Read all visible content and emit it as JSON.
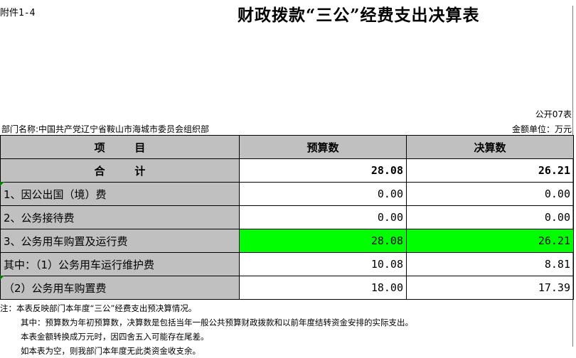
{
  "attachment": "附件1-4",
  "title": "财政拨款“三公”经费支出决算表",
  "form_number": "公开07表",
  "department": "部门名称:中国共产党辽宁省鞍山市海城市委员会组织部",
  "unit": "金额单位：万元",
  "headers": [
    "项        目",
    "预算数",
    "决算数"
  ],
  "rows": [
    {
      "label": "合        计",
      "budget": "28.08",
      "final": "26.21"
    },
    {
      "label": "1、因公出国（境）费",
      "budget": "0.00",
      "final": "0.00"
    },
    {
      "label": "2、公务接待费",
      "budget": "0.00",
      "final": "0.00"
    },
    {
      "label": "3、公务用车购置及运行费",
      "budget": "28.08",
      "final": "26.21"
    },
    {
      "label": "其中：（1）公务用车运行维护费",
      "budget": "10.08",
      "final": "8.81"
    },
    {
      "label": "（2）公务用车购置费",
      "budget": "18.00",
      "final": "17.39"
    }
  ],
  "notes": [
    "注：本表反映部门本年度“三公”经费支出预决算情况。",
    "其中：预算数为年初预算数，决算数是包括当年一般公共预算财政拨款和以前年度结转资金安排的实际支出。",
    "本表金额转换成万元时，因四舍五入可能存在尾差。",
    "如本表为空，则我部门本年度无此类资金收支余。"
  ],
  "colors": {
    "header_fill": "#c0c0c0",
    "highlight_fill": "#00ff00"
  }
}
